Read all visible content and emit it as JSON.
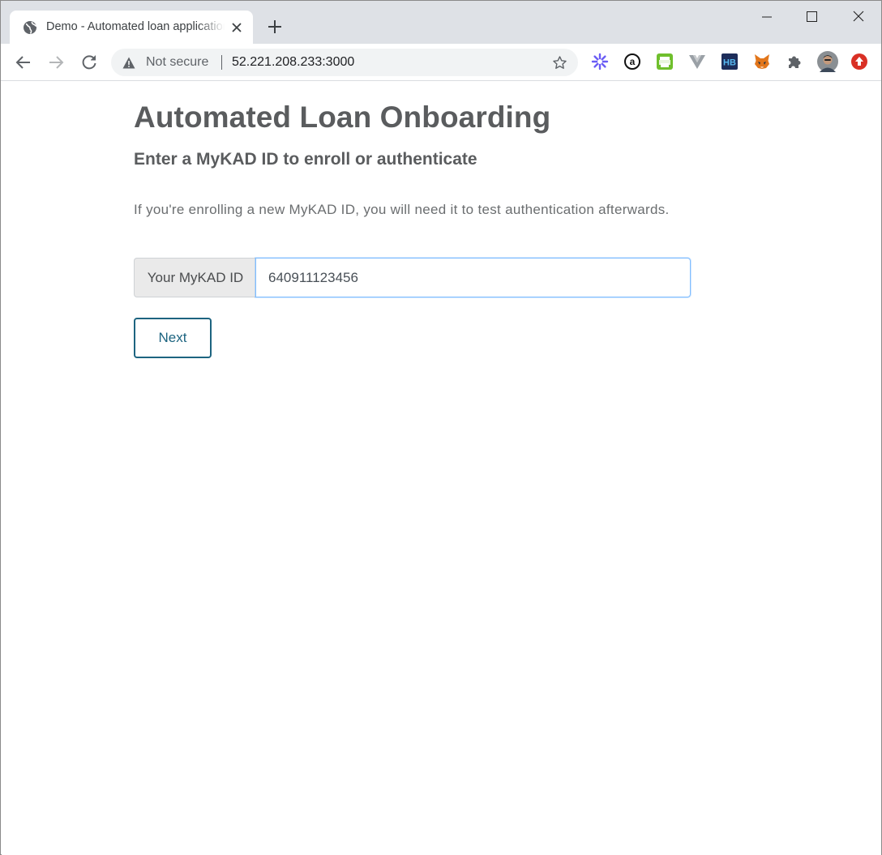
{
  "browser": {
    "tab": {
      "title": "Demo - Automated loan application",
      "favicon": "globe-icon"
    },
    "address_bar": {
      "security_label": "Not secure",
      "url": "52.221.208.233:3000"
    },
    "extensions": [
      "asterisk-extension-icon",
      "amazon-assistant-icon",
      "printer-extension-icon",
      "vue-devtools-icon",
      "hb-extension-icon",
      "metamask-fox-icon",
      "puzzle-extensions-icon",
      "profile-avatar",
      "update-icon"
    ]
  },
  "page": {
    "title": "Automated Loan Onboarding",
    "subtitle": "Enter a MyKAD ID to enroll or authenticate",
    "description": "If you're enrolling a new MyKAD ID, you will need it to test authentication afterwards.",
    "id_field": {
      "label": "Your MyKAD ID",
      "value": "640911123456"
    },
    "next_label": "Next"
  },
  "colors": {
    "heading": "#5a5c5e",
    "button_accent": "#1d6480",
    "input_focus": "#80bdff"
  }
}
